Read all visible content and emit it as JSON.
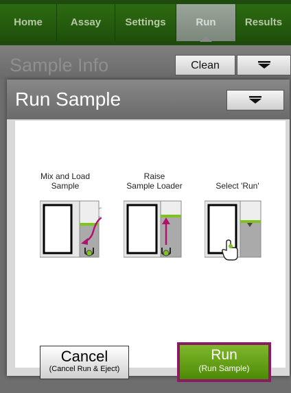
{
  "nav": {
    "tabs": [
      {
        "label": "Home",
        "active": false
      },
      {
        "label": "Assay",
        "active": false
      },
      {
        "label": "Settings",
        "active": false
      },
      {
        "label": "Run",
        "active": true
      },
      {
        "label": "Results",
        "active": false
      }
    ]
  },
  "background": {
    "title": "Sample Info",
    "clean_label": "Clean",
    "menu_icon": "dropdown-menu-icon"
  },
  "dialog": {
    "title": "Run Sample",
    "menu_icon": "dropdown-menu-icon",
    "steps": [
      {
        "label_line1": "Mix and Load",
        "label_line2": "Sample",
        "icon": "mix-load-sample-illustration"
      },
      {
        "label_line1": "Raise",
        "label_line2": "Sample Loader",
        "icon": "raise-sample-loader-illustration"
      },
      {
        "label_line1": "Select 'Run'",
        "label_line2": "",
        "icon": "select-run-illustration"
      }
    ],
    "cancel_button": {
      "label": "Cancel",
      "sublabel": "(Cancel  Run & Eject)"
    },
    "run_button": {
      "label": "Run",
      "sublabel": "(Run Sample)"
    }
  },
  "colors": {
    "nav_green": "#2d6b12",
    "run_green": "#5a9a10",
    "run_border": "#8a1a64",
    "arrow_magenta": "#b0126e",
    "accent_green": "#7fc31c"
  }
}
